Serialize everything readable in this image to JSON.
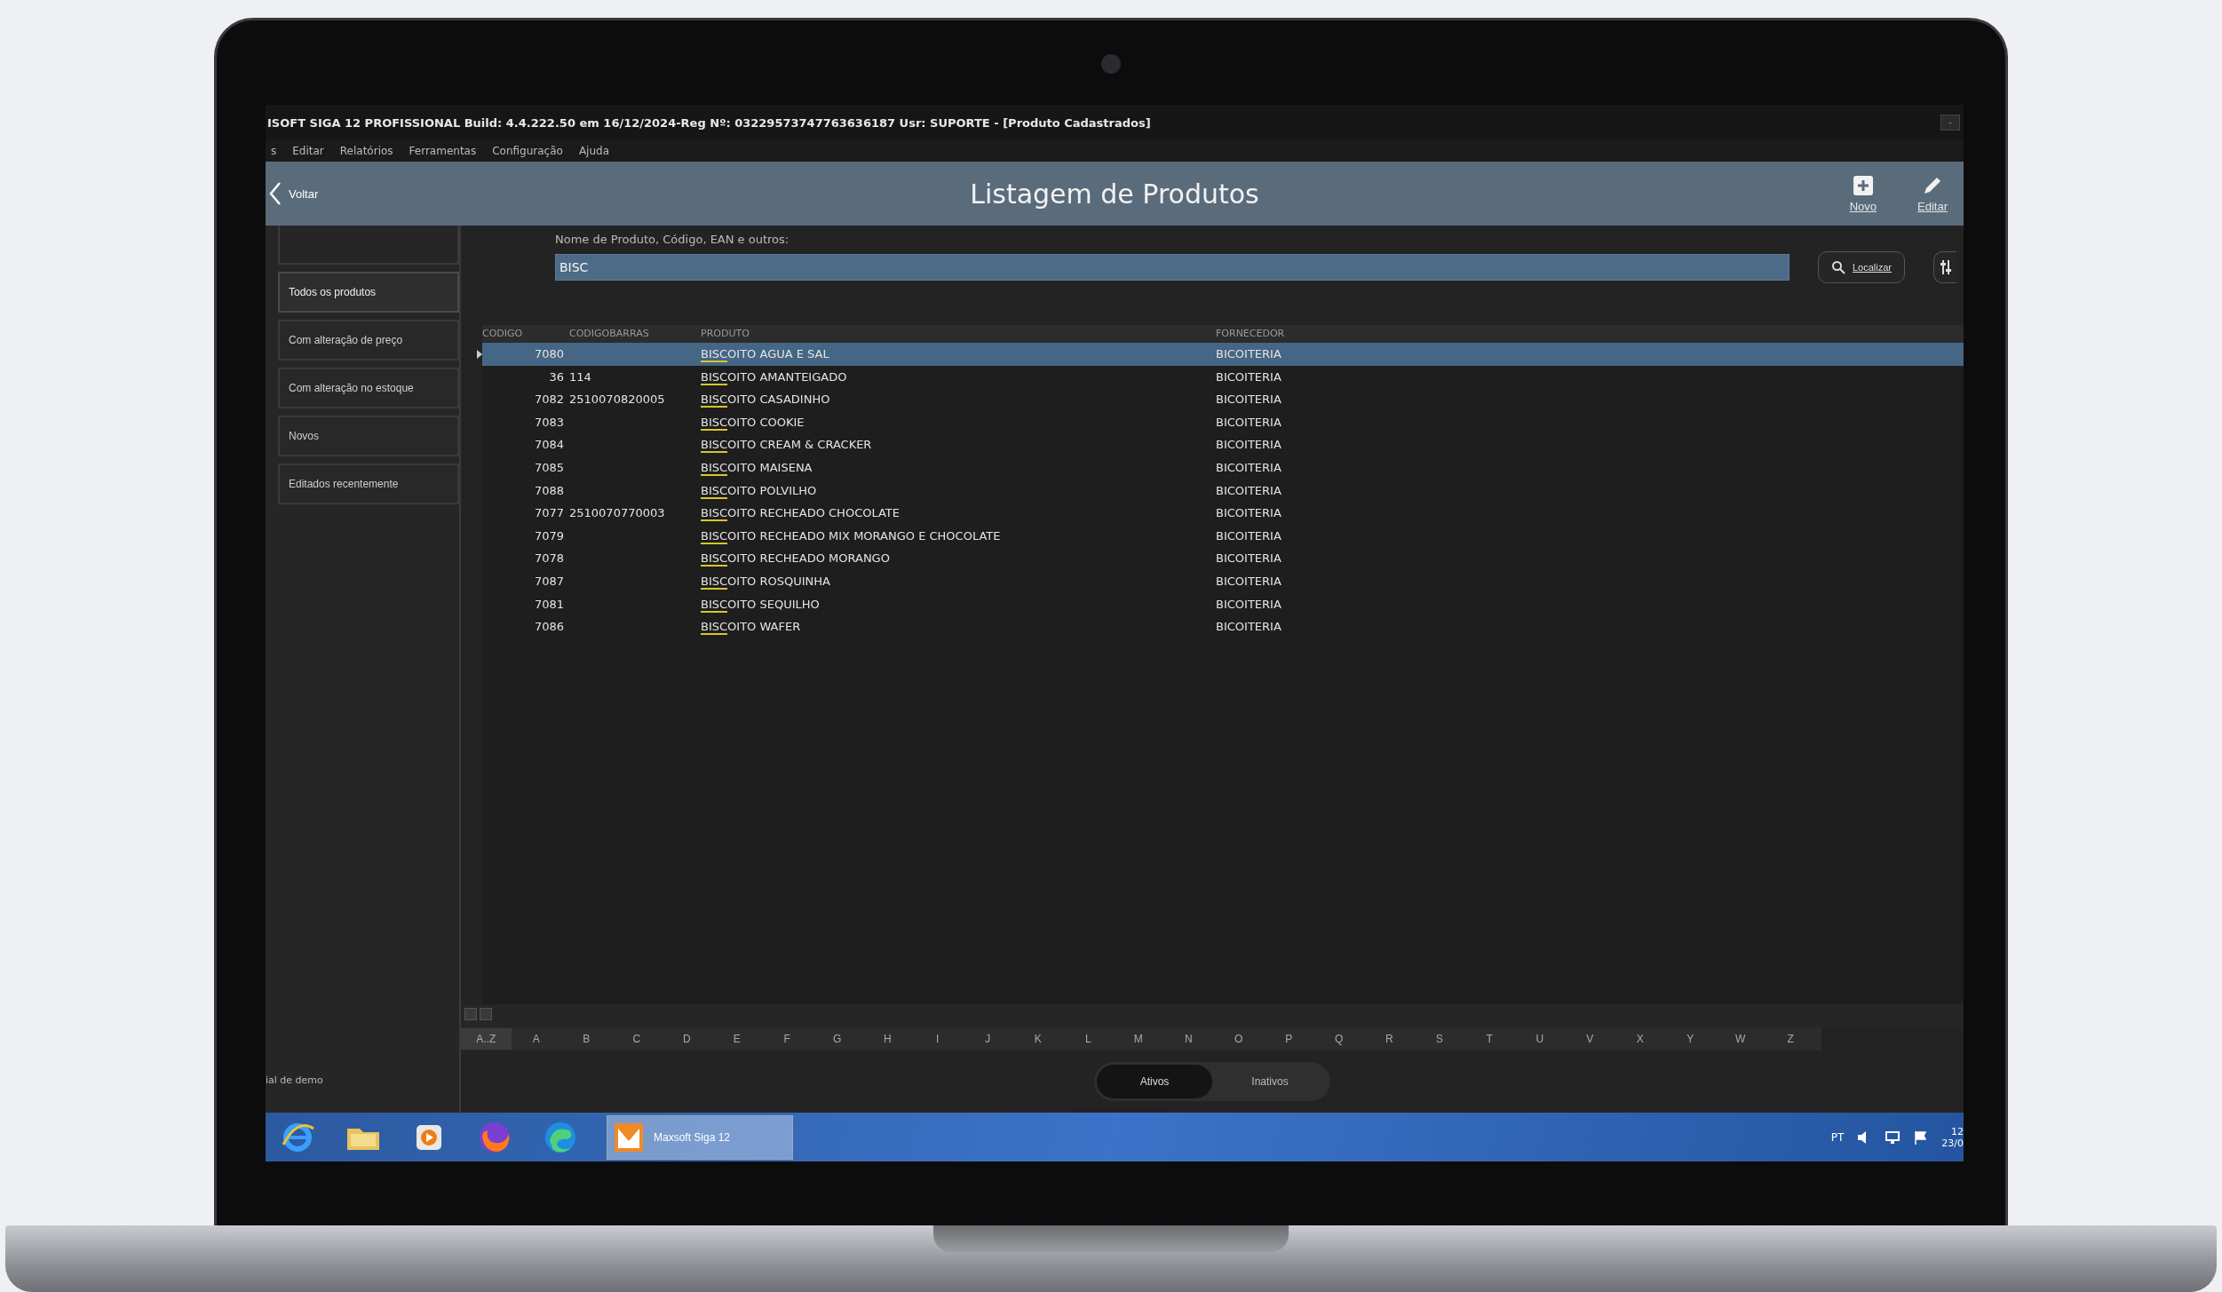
{
  "window": {
    "title": "ISOFT SIGA 12 PROFISSIONAL  Build: 4.4.222.50 em 16/12/2024-Reg Nº: 03229573747763636187 Usr: SUPORTE - [Produto Cadastrados]",
    "controls": [
      "-"
    ]
  },
  "menu": [
    "s",
    "Editar",
    "Relatórios",
    "Ferramentas",
    "Configuração",
    "Ajuda"
  ],
  "header": {
    "back": "Voltar",
    "title": "Listagem de Produtos",
    "actions": [
      {
        "kind": "new",
        "label": "Novo"
      },
      {
        "kind": "edit",
        "label": "Editar"
      }
    ]
  },
  "sidebar": {
    "items": [
      {
        "label": "Todos os produtos",
        "selected": true
      },
      {
        "label": "Com alteração de preço",
        "selected": false
      },
      {
        "label": "Com alteração no estoque",
        "selected": false
      },
      {
        "label": "Novos",
        "selected": false
      },
      {
        "label": "Editados recentemente",
        "selected": false
      }
    ],
    "footer": "ial de demo"
  },
  "search": {
    "label": "Nome de Produto, Código, EAN e outros:",
    "value": "BISC",
    "button": "Localizar"
  },
  "table": {
    "columns": [
      "CODIGO",
      "CODIGOBARRAS",
      "PRODUTO",
      "FORNECEDOR"
    ],
    "rows": [
      {
        "code": "7080",
        "barcode": "",
        "product": {
          "match": "BISC",
          "rest": "OITO AGUA E SAL"
        },
        "supplier": "BICOITERIA",
        "selected": true
      },
      {
        "code": "36",
        "barcode": "114",
        "product": {
          "match": "BISC",
          "rest": "OITO AMANTEIGADO"
        },
        "supplier": "BICOITERIA",
        "selected": false
      },
      {
        "code": "7082",
        "barcode": "2510070820005",
        "product": {
          "match": "BISC",
          "rest": "OITO CASADINHO"
        },
        "supplier": "BICOITERIA",
        "selected": false
      },
      {
        "code": "7083",
        "barcode": "",
        "product": {
          "match": "BISC",
          "rest": "OITO COOKIE"
        },
        "supplier": "BICOITERIA",
        "selected": false
      },
      {
        "code": "7084",
        "barcode": "",
        "product": {
          "match": "BISC",
          "rest": "OITO CREAM & CRACKER"
        },
        "supplier": "BICOITERIA",
        "selected": false
      },
      {
        "code": "7085",
        "barcode": "",
        "product": {
          "match": "BISC",
          "rest": "OITO MAISENA"
        },
        "supplier": "BICOITERIA",
        "selected": false
      },
      {
        "code": "7088",
        "barcode": "",
        "product": {
          "match": "BISC",
          "rest": "OITO POLVILHO"
        },
        "supplier": "BICOITERIA",
        "selected": false
      },
      {
        "code": "7077",
        "barcode": "2510070770003",
        "product": {
          "match": "BISC",
          "rest": "OITO RECHEADO CHOCOLATE"
        },
        "supplier": "BICOITERIA",
        "selected": false
      },
      {
        "code": "7079",
        "barcode": "",
        "product": {
          "match": "BISC",
          "rest": "OITO RECHEADO MIX MORANGO E CHOCOLATE"
        },
        "supplier": "BICOITERIA",
        "selected": false
      },
      {
        "code": "7078",
        "barcode": "",
        "product": {
          "match": "BISC",
          "rest": "OITO RECHEADO MORANGO"
        },
        "supplier": "BICOITERIA",
        "selected": false
      },
      {
        "code": "7087",
        "barcode": "",
        "product": {
          "match": "BISC",
          "rest": "OITO ROSQUINHA"
        },
        "supplier": "BICOITERIA",
        "selected": false
      },
      {
        "code": "7081",
        "barcode": "",
        "product": {
          "match": "BISC",
          "rest": "OITO SEQUILHO"
        },
        "supplier": "BICOITERIA",
        "selected": false
      },
      {
        "code": "7086",
        "barcode": "",
        "product": {
          "match": "BISC",
          "rest": "OITO WAFER"
        },
        "supplier": "BICOITERIA",
        "selected": false
      }
    ]
  },
  "alphabet": [
    "A..Z",
    "A",
    "B",
    "C",
    "D",
    "E",
    "F",
    "G",
    "H",
    "I",
    "J",
    "K",
    "L",
    "M",
    "N",
    "O",
    "P",
    "Q",
    "R",
    "S",
    "T",
    "U",
    "V",
    "X",
    "Y",
    "W",
    "Z"
  ],
  "status_filter": [
    {
      "label": "Ativos",
      "selected": true
    },
    {
      "label": "Inativos",
      "selected": false
    }
  ],
  "taskbar": {
    "apps": [
      {
        "kind": "ie"
      },
      {
        "kind": "folder"
      },
      {
        "kind": "media"
      },
      {
        "kind": "firefox"
      },
      {
        "kind": "edge"
      }
    ],
    "window": "Maxsoft Siga 12",
    "tray": {
      "lang": "PT",
      "time": "12",
      "date": "23/0"
    }
  }
}
